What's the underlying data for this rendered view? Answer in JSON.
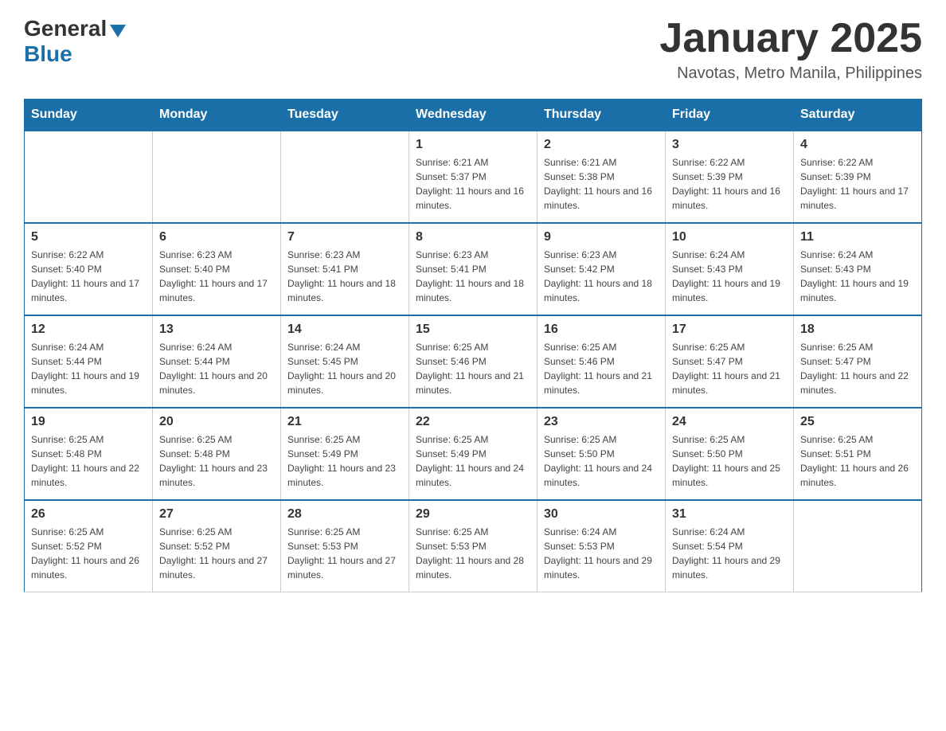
{
  "logo": {
    "text_general": "General",
    "text_blue": "Blue"
  },
  "header": {
    "month_year": "January 2025",
    "location": "Navotas, Metro Manila, Philippines"
  },
  "weekdays": [
    "Sunday",
    "Monday",
    "Tuesday",
    "Wednesday",
    "Thursday",
    "Friday",
    "Saturday"
  ],
  "weeks": [
    [
      {
        "day": "",
        "info": ""
      },
      {
        "day": "",
        "info": ""
      },
      {
        "day": "",
        "info": ""
      },
      {
        "day": "1",
        "info": "Sunrise: 6:21 AM\nSunset: 5:37 PM\nDaylight: 11 hours and 16 minutes."
      },
      {
        "day": "2",
        "info": "Sunrise: 6:21 AM\nSunset: 5:38 PM\nDaylight: 11 hours and 16 minutes."
      },
      {
        "day": "3",
        "info": "Sunrise: 6:22 AM\nSunset: 5:39 PM\nDaylight: 11 hours and 16 minutes."
      },
      {
        "day": "4",
        "info": "Sunrise: 6:22 AM\nSunset: 5:39 PM\nDaylight: 11 hours and 17 minutes."
      }
    ],
    [
      {
        "day": "5",
        "info": "Sunrise: 6:22 AM\nSunset: 5:40 PM\nDaylight: 11 hours and 17 minutes."
      },
      {
        "day": "6",
        "info": "Sunrise: 6:23 AM\nSunset: 5:40 PM\nDaylight: 11 hours and 17 minutes."
      },
      {
        "day": "7",
        "info": "Sunrise: 6:23 AM\nSunset: 5:41 PM\nDaylight: 11 hours and 18 minutes."
      },
      {
        "day": "8",
        "info": "Sunrise: 6:23 AM\nSunset: 5:41 PM\nDaylight: 11 hours and 18 minutes."
      },
      {
        "day": "9",
        "info": "Sunrise: 6:23 AM\nSunset: 5:42 PM\nDaylight: 11 hours and 18 minutes."
      },
      {
        "day": "10",
        "info": "Sunrise: 6:24 AM\nSunset: 5:43 PM\nDaylight: 11 hours and 19 minutes."
      },
      {
        "day": "11",
        "info": "Sunrise: 6:24 AM\nSunset: 5:43 PM\nDaylight: 11 hours and 19 minutes."
      }
    ],
    [
      {
        "day": "12",
        "info": "Sunrise: 6:24 AM\nSunset: 5:44 PM\nDaylight: 11 hours and 19 minutes."
      },
      {
        "day": "13",
        "info": "Sunrise: 6:24 AM\nSunset: 5:44 PM\nDaylight: 11 hours and 20 minutes."
      },
      {
        "day": "14",
        "info": "Sunrise: 6:24 AM\nSunset: 5:45 PM\nDaylight: 11 hours and 20 minutes."
      },
      {
        "day": "15",
        "info": "Sunrise: 6:25 AM\nSunset: 5:46 PM\nDaylight: 11 hours and 21 minutes."
      },
      {
        "day": "16",
        "info": "Sunrise: 6:25 AM\nSunset: 5:46 PM\nDaylight: 11 hours and 21 minutes."
      },
      {
        "day": "17",
        "info": "Sunrise: 6:25 AM\nSunset: 5:47 PM\nDaylight: 11 hours and 21 minutes."
      },
      {
        "day": "18",
        "info": "Sunrise: 6:25 AM\nSunset: 5:47 PM\nDaylight: 11 hours and 22 minutes."
      }
    ],
    [
      {
        "day": "19",
        "info": "Sunrise: 6:25 AM\nSunset: 5:48 PM\nDaylight: 11 hours and 22 minutes."
      },
      {
        "day": "20",
        "info": "Sunrise: 6:25 AM\nSunset: 5:48 PM\nDaylight: 11 hours and 23 minutes."
      },
      {
        "day": "21",
        "info": "Sunrise: 6:25 AM\nSunset: 5:49 PM\nDaylight: 11 hours and 23 minutes."
      },
      {
        "day": "22",
        "info": "Sunrise: 6:25 AM\nSunset: 5:49 PM\nDaylight: 11 hours and 24 minutes."
      },
      {
        "day": "23",
        "info": "Sunrise: 6:25 AM\nSunset: 5:50 PM\nDaylight: 11 hours and 24 minutes."
      },
      {
        "day": "24",
        "info": "Sunrise: 6:25 AM\nSunset: 5:50 PM\nDaylight: 11 hours and 25 minutes."
      },
      {
        "day": "25",
        "info": "Sunrise: 6:25 AM\nSunset: 5:51 PM\nDaylight: 11 hours and 26 minutes."
      }
    ],
    [
      {
        "day": "26",
        "info": "Sunrise: 6:25 AM\nSunset: 5:52 PM\nDaylight: 11 hours and 26 minutes."
      },
      {
        "day": "27",
        "info": "Sunrise: 6:25 AM\nSunset: 5:52 PM\nDaylight: 11 hours and 27 minutes."
      },
      {
        "day": "28",
        "info": "Sunrise: 6:25 AM\nSunset: 5:53 PM\nDaylight: 11 hours and 27 minutes."
      },
      {
        "day": "29",
        "info": "Sunrise: 6:25 AM\nSunset: 5:53 PM\nDaylight: 11 hours and 28 minutes."
      },
      {
        "day": "30",
        "info": "Sunrise: 6:24 AM\nSunset: 5:53 PM\nDaylight: 11 hours and 29 minutes."
      },
      {
        "day": "31",
        "info": "Sunrise: 6:24 AM\nSunset: 5:54 PM\nDaylight: 11 hours and 29 minutes."
      },
      {
        "day": "",
        "info": ""
      }
    ]
  ]
}
